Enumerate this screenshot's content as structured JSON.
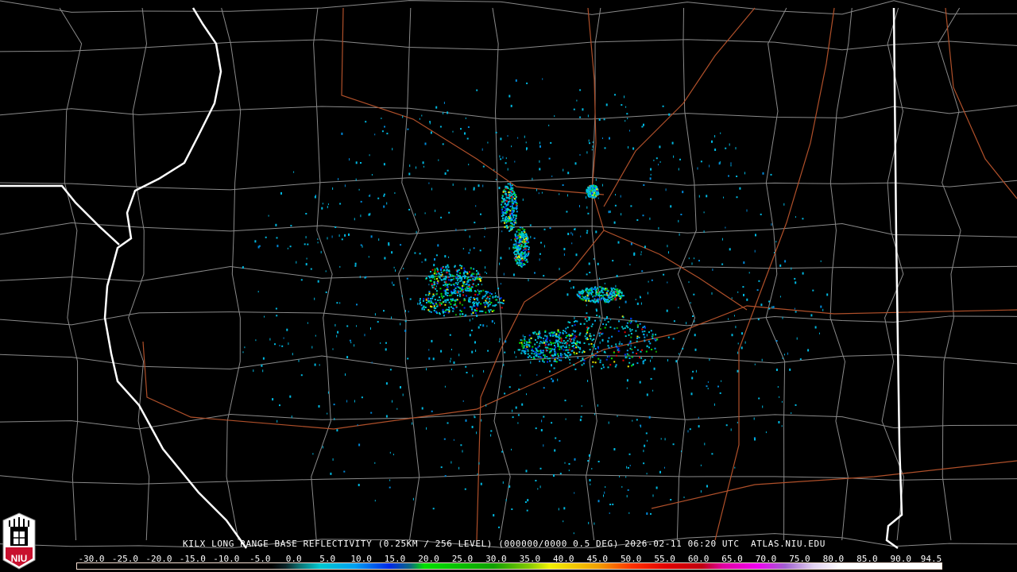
{
  "product": {
    "caption": "KILX LONG RANGE BASE REFLECTIVITY (0.25KM / 256 LEVEL) (000000/0000 0.5 DEG) 2026-02-11 06:20 UTC  ATLAS.NIU.EDU",
    "station": "KILX",
    "timestamp": "2026-02-11 06:20 UTC",
    "site": "ATLAS.NIU.EDU"
  },
  "logo": {
    "text": "NIU",
    "color": "#c8102e"
  },
  "colorbar": {
    "units_min": -30.0,
    "units_max": 94.5,
    "labels": [
      "-30.0",
      "-25.0",
      "-20.0",
      "-15.0",
      "-10.0",
      "-5.0",
      "0.0",
      "5.0",
      "10.0",
      "15.0",
      "20.0",
      "25.0",
      "30.0",
      "35.0",
      "40.0",
      "45.0",
      "50.0",
      "55.0",
      "60.0",
      "65.0",
      "70.0",
      "75.0",
      "80.0",
      "85.0",
      "90.0",
      "94.5"
    ],
    "stops": [
      {
        "v": -30,
        "c": "#000000"
      },
      {
        "v": -2,
        "c": "#000000"
      },
      {
        "v": 0,
        "c": "#0a2226"
      },
      {
        "v": 2,
        "c": "#0c7070"
      },
      {
        "v": 5,
        "c": "#00c8d0"
      },
      {
        "v": 10,
        "c": "#00a0f0"
      },
      {
        "v": 15,
        "c": "#0028e8"
      },
      {
        "v": 18,
        "c": "#0a6a80"
      },
      {
        "v": 20,
        "c": "#00e000"
      },
      {
        "v": 30,
        "c": "#10a000"
      },
      {
        "v": 35,
        "c": "#80c800"
      },
      {
        "v": 38,
        "c": "#f0f000"
      },
      {
        "v": 45,
        "c": "#f0a000"
      },
      {
        "v": 50,
        "c": "#ff3000"
      },
      {
        "v": 55,
        "c": "#e00000"
      },
      {
        "v": 60,
        "c": "#c00010"
      },
      {
        "v": 63,
        "c": "#e000a0"
      },
      {
        "v": 68,
        "c": "#f000f0"
      },
      {
        "v": 72,
        "c": "#a060d0"
      },
      {
        "v": 76,
        "c": "#e0d0f0"
      },
      {
        "v": 80,
        "c": "#ffffff"
      },
      {
        "v": 94.5,
        "c": "#ffffff"
      }
    ]
  },
  "colors": {
    "state": "#ffffff",
    "county": "#8a8a8a",
    "road": "#b0502a",
    "echo": "#00b8e0"
  }
}
